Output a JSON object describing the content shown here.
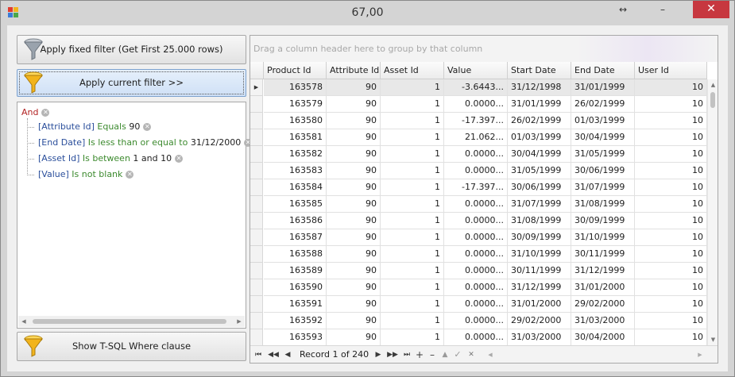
{
  "window": {
    "title": "67,00",
    "resize_glyph": "↔",
    "minimize_glyph": "–",
    "close_glyph": "✕"
  },
  "buttons": {
    "fixed_filter": "Apply fixed filter (Get First 25.000 rows)",
    "current_filter": "Apply current filter >>",
    "show_sql": "Show T-SQL Where clause"
  },
  "filter": {
    "group_op": "And",
    "conditions": [
      {
        "field": "[Attribute Id]",
        "op": "Equals",
        "value": "90"
      },
      {
        "field": "[End Date]",
        "op": "Is less than or equal to",
        "value": "31/12/2000"
      },
      {
        "field": "[Asset Id]",
        "op": "Is between",
        "value": "1 and 10"
      },
      {
        "field": "[Value]",
        "op": "Is not blank",
        "value": ""
      }
    ],
    "remove_glyph": "✕"
  },
  "grid": {
    "group_panel_text": "Drag a column header here to group by that column",
    "columns": [
      "Product Id",
      "Attribute Id",
      "Asset Id",
      "Value",
      "Start Date",
      "End Date",
      "User Id"
    ],
    "rows": [
      [
        "163578",
        "90",
        "1",
        "-3.6443...",
        "31/12/1998",
        "31/01/1999",
        "10"
      ],
      [
        "163579",
        "90",
        "1",
        "0.0000...",
        "31/01/1999",
        "26/02/1999",
        "10"
      ],
      [
        "163580",
        "90",
        "1",
        "-17.397...",
        "26/02/1999",
        "01/03/1999",
        "10"
      ],
      [
        "163581",
        "90",
        "1",
        "21.062...",
        "01/03/1999",
        "30/04/1999",
        "10"
      ],
      [
        "163582",
        "90",
        "1",
        "0.0000...",
        "30/04/1999",
        "31/05/1999",
        "10"
      ],
      [
        "163583",
        "90",
        "1",
        "0.0000...",
        "31/05/1999",
        "30/06/1999",
        "10"
      ],
      [
        "163584",
        "90",
        "1",
        "-17.397...",
        "30/06/1999",
        "31/07/1999",
        "10"
      ],
      [
        "163585",
        "90",
        "1",
        "0.0000...",
        "31/07/1999",
        "31/08/1999",
        "10"
      ],
      [
        "163586",
        "90",
        "1",
        "0.0000...",
        "31/08/1999",
        "30/09/1999",
        "10"
      ],
      [
        "163587",
        "90",
        "1",
        "0.0000...",
        "30/09/1999",
        "31/10/1999",
        "10"
      ],
      [
        "163588",
        "90",
        "1",
        "0.0000...",
        "31/10/1999",
        "30/11/1999",
        "10"
      ],
      [
        "163589",
        "90",
        "1",
        "0.0000...",
        "30/11/1999",
        "31/12/1999",
        "10"
      ],
      [
        "163590",
        "90",
        "1",
        "0.0000...",
        "31/12/1999",
        "31/01/2000",
        "10"
      ],
      [
        "163591",
        "90",
        "1",
        "0.0000...",
        "31/01/2000",
        "29/02/2000",
        "10"
      ],
      [
        "163592",
        "90",
        "1",
        "0.0000...",
        "29/02/2000",
        "31/03/2000",
        "10"
      ],
      [
        "163593",
        "90",
        "1",
        "0.0000...",
        "31/03/2000",
        "30/04/2000",
        "10"
      ]
    ],
    "row_indicator": "▶"
  },
  "navigator": {
    "record_text": "Record 1 of 240",
    "first": "⏮",
    "prev_page": "◀◀",
    "prev": "◀",
    "next": "▶",
    "next_page": "▶▶",
    "last": "⏭",
    "append": "+",
    "delete": "–",
    "up": "▲",
    "check": "✓",
    "cancel": "✕"
  },
  "colors": {
    "close_button": "#c7373f",
    "and_operator": "#b22222",
    "field_text": "#2a4e9b",
    "operator_text": "#3c8a2e",
    "funnel_gold": "#f2b41c",
    "funnel_silver": "#9aa3ad"
  }
}
